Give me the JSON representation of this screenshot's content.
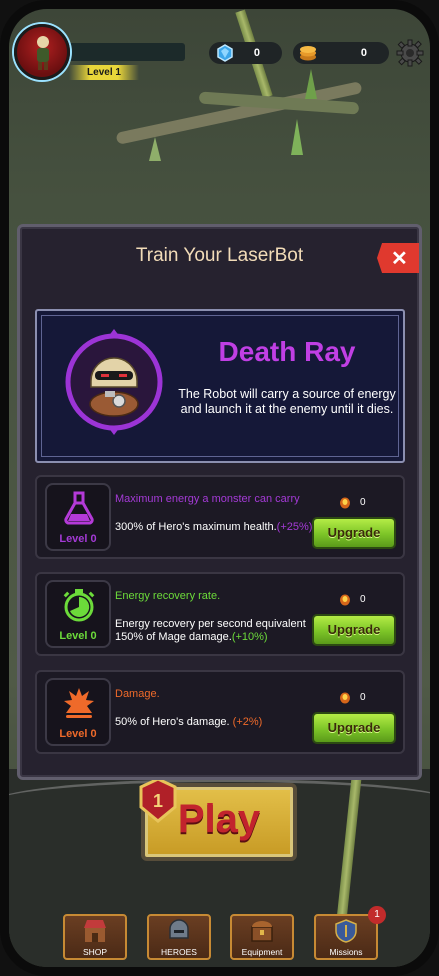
{
  "hud": {
    "level_label": "Level 1",
    "gems": "0",
    "coins": "0"
  },
  "modal": {
    "title": "Train Your LaserBot",
    "close_label": "✕",
    "hero": {
      "name": "Death Ray",
      "description": "The Robot will carry a source of energy and launch it at the enemy until it dies."
    },
    "upgrades": [
      {
        "title": "Maximum energy a monster can carry",
        "desc": "300% of Hero's maximum health.",
        "bonus": "(+25%)",
        "level": "Level 0",
        "cost": "0",
        "button": "Upgrade",
        "color": "#a43ad6"
      },
      {
        "title": "Energy recovery rate.",
        "desc": "Energy recovery per second equivalent 150% of Mage damage.",
        "bonus": "(+10%)",
        "level": "Level 0",
        "cost": "0",
        "button": "Upgrade",
        "color": "#6cdb3a"
      },
      {
        "title": "Damage.",
        "desc": "50% of Hero's damage.",
        "bonus": "(+2%)",
        "level": "Level 0",
        "cost": "0",
        "button": "Upgrade",
        "color": "#ef6a2a"
      }
    ]
  },
  "play": {
    "label": "Play",
    "badge": "1"
  },
  "nav": {
    "items": [
      "SHOP",
      "HEROES",
      "Equipment",
      "Missions"
    ],
    "missions_badge": "1"
  }
}
